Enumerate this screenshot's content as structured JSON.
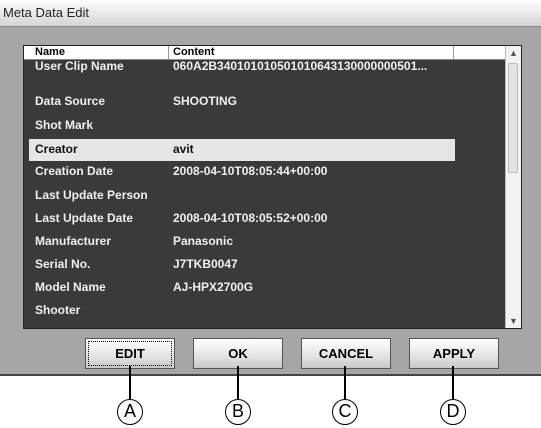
{
  "window": {
    "title": "Meta Data Edit"
  },
  "columns": {
    "name": "Name",
    "content": "Content"
  },
  "rows": [
    {
      "name": "User Clip Name",
      "content": "060A2B340101010501010643130000000501..."
    },
    {
      "name": "Data Source",
      "content": "SHOOTING"
    },
    {
      "name": "Shot Mark",
      "content": ""
    },
    {
      "name": "Creator",
      "content": "avit",
      "selected": true
    },
    {
      "name": "Creation Date",
      "content": "2008-04-10T08:05:44+00:00"
    },
    {
      "name": "Last Update Person",
      "content": ""
    },
    {
      "name": "Last Update Date",
      "content": "2008-04-10T08:05:52+00:00"
    },
    {
      "name": "Manufacturer",
      "content": "Panasonic"
    },
    {
      "name": "Serial No.",
      "content": "J7TKB0047"
    },
    {
      "name": "Model Name",
      "content": "AJ-HPX2700G"
    },
    {
      "name": "Shooter",
      "content": ""
    }
  ],
  "buttons": {
    "edit": "EDIT",
    "ok": "OK",
    "cancel": "CANCEL",
    "apply": "APPLY"
  },
  "callouts": [
    "A",
    "B",
    "C",
    "D"
  ],
  "colors": {
    "list_bg": "#3a3a3a",
    "dialog_bg": "#a6a6a6",
    "selected_row": "#e6e6e6"
  }
}
